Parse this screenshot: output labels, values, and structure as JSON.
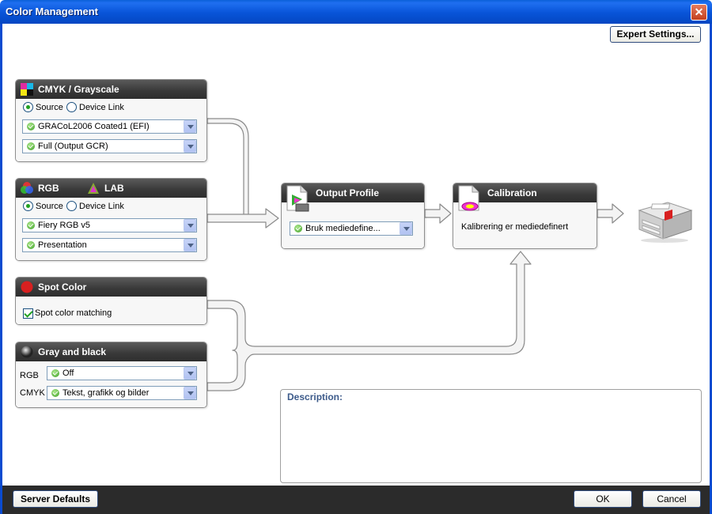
{
  "window": {
    "title": "Color Management",
    "close_label": "✕"
  },
  "toolbar": {
    "expert_settings": "Expert Settings..."
  },
  "cmyk": {
    "title": "CMYK / Grayscale",
    "source_label": "Source",
    "device_link_label": "Device Link",
    "source_profile": "GRACoL2006 Coated1 (EFI)",
    "gcr": "Full (Output GCR)"
  },
  "rgb": {
    "title": "RGB",
    "title2": "LAB",
    "source_label": "Source",
    "device_link_label": "Device Link",
    "source_profile": "Fiery RGB v5",
    "rendering": "Presentation"
  },
  "spot": {
    "title": "Spot Color",
    "matching_label": "Spot color matching"
  },
  "gray": {
    "title": "Gray and black",
    "rgb_label": "RGB",
    "rgb_value": "Off",
    "cmyk_label": "CMYK",
    "cmyk_value": "Tekst, grafikk og bilder"
  },
  "output": {
    "title": "Output Profile",
    "value": "Bruk mediedefine..."
  },
  "calibration": {
    "title": "Calibration",
    "text": "Kalibrering er mediedefinert"
  },
  "description": {
    "label": "Description:"
  },
  "footer": {
    "server_defaults": "Server Defaults",
    "ok": "OK",
    "cancel": "Cancel"
  }
}
